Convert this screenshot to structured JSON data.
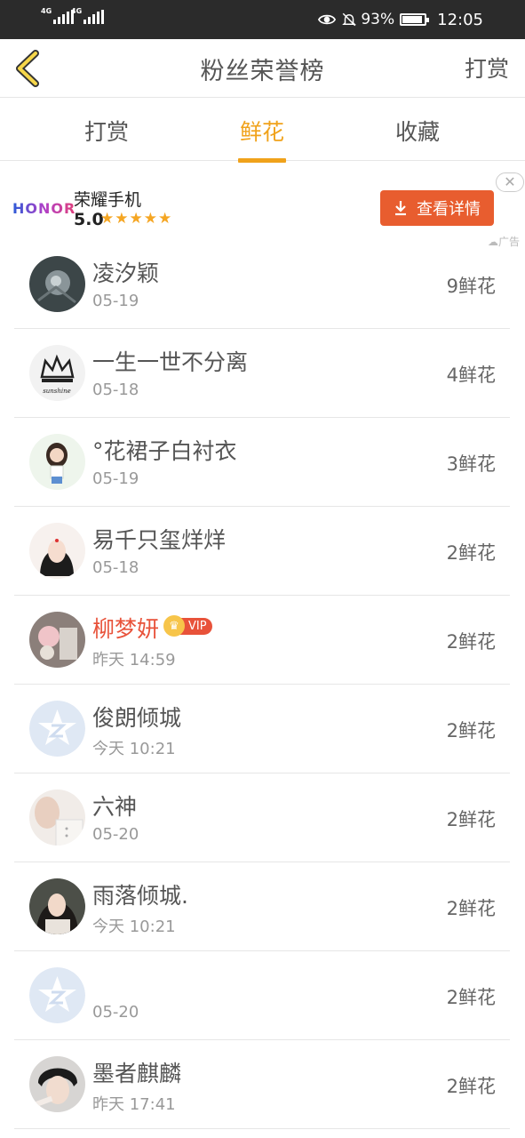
{
  "status_bar": {
    "signal1": "4G",
    "signal2": "4G",
    "battery": "93%",
    "time": "12:05"
  },
  "header": {
    "title": "粉丝荣誉榜",
    "right_action": "打赏"
  },
  "tabs": [
    {
      "label": "打赏",
      "active": false
    },
    {
      "label": "鲜花",
      "active": true
    },
    {
      "label": "收藏",
      "active": false
    }
  ],
  "ad": {
    "brand": "HONOR",
    "name": "荣耀手机",
    "rating": "5.0",
    "stars": "★★★★★",
    "button": "查看详情",
    "tag": "广告",
    "close": "✕"
  },
  "list": [
    {
      "name": "凌汐颖",
      "date": "05-19",
      "count": "9鲜花",
      "vip": false
    },
    {
      "name": "一生一世不分离",
      "date": "05-18",
      "count": "4鲜花",
      "vip": false
    },
    {
      "name": "°花裙子白衬衣",
      "date": "05-19",
      "count": "3鲜花",
      "vip": false
    },
    {
      "name": "易千只玺烊烊",
      "date": "05-18",
      "count": "2鲜花",
      "vip": false
    },
    {
      "name": "柳梦妍",
      "date": "昨天 14:59",
      "count": "2鲜花",
      "vip": true,
      "vip_label": "VIP"
    },
    {
      "name": "俊朗倾城",
      "date": "今天 10:21",
      "count": "2鲜花",
      "vip": false
    },
    {
      "name": "六神",
      "date": "05-20",
      "count": "2鲜花",
      "vip": false
    },
    {
      "name": "雨落倾城.",
      "date": "今天 10:21",
      "count": "2鲜花",
      "vip": false
    },
    {
      "name": "",
      "date": "05-20",
      "count": "2鲜花",
      "vip": false
    },
    {
      "name": "墨者麒麟",
      "date": "昨天 17:41",
      "count": "2鲜花",
      "vip": false
    }
  ],
  "colors": {
    "accent": "#f0a21b",
    "ad_button": "#e85d2f",
    "vip_red": "#e8523a"
  }
}
